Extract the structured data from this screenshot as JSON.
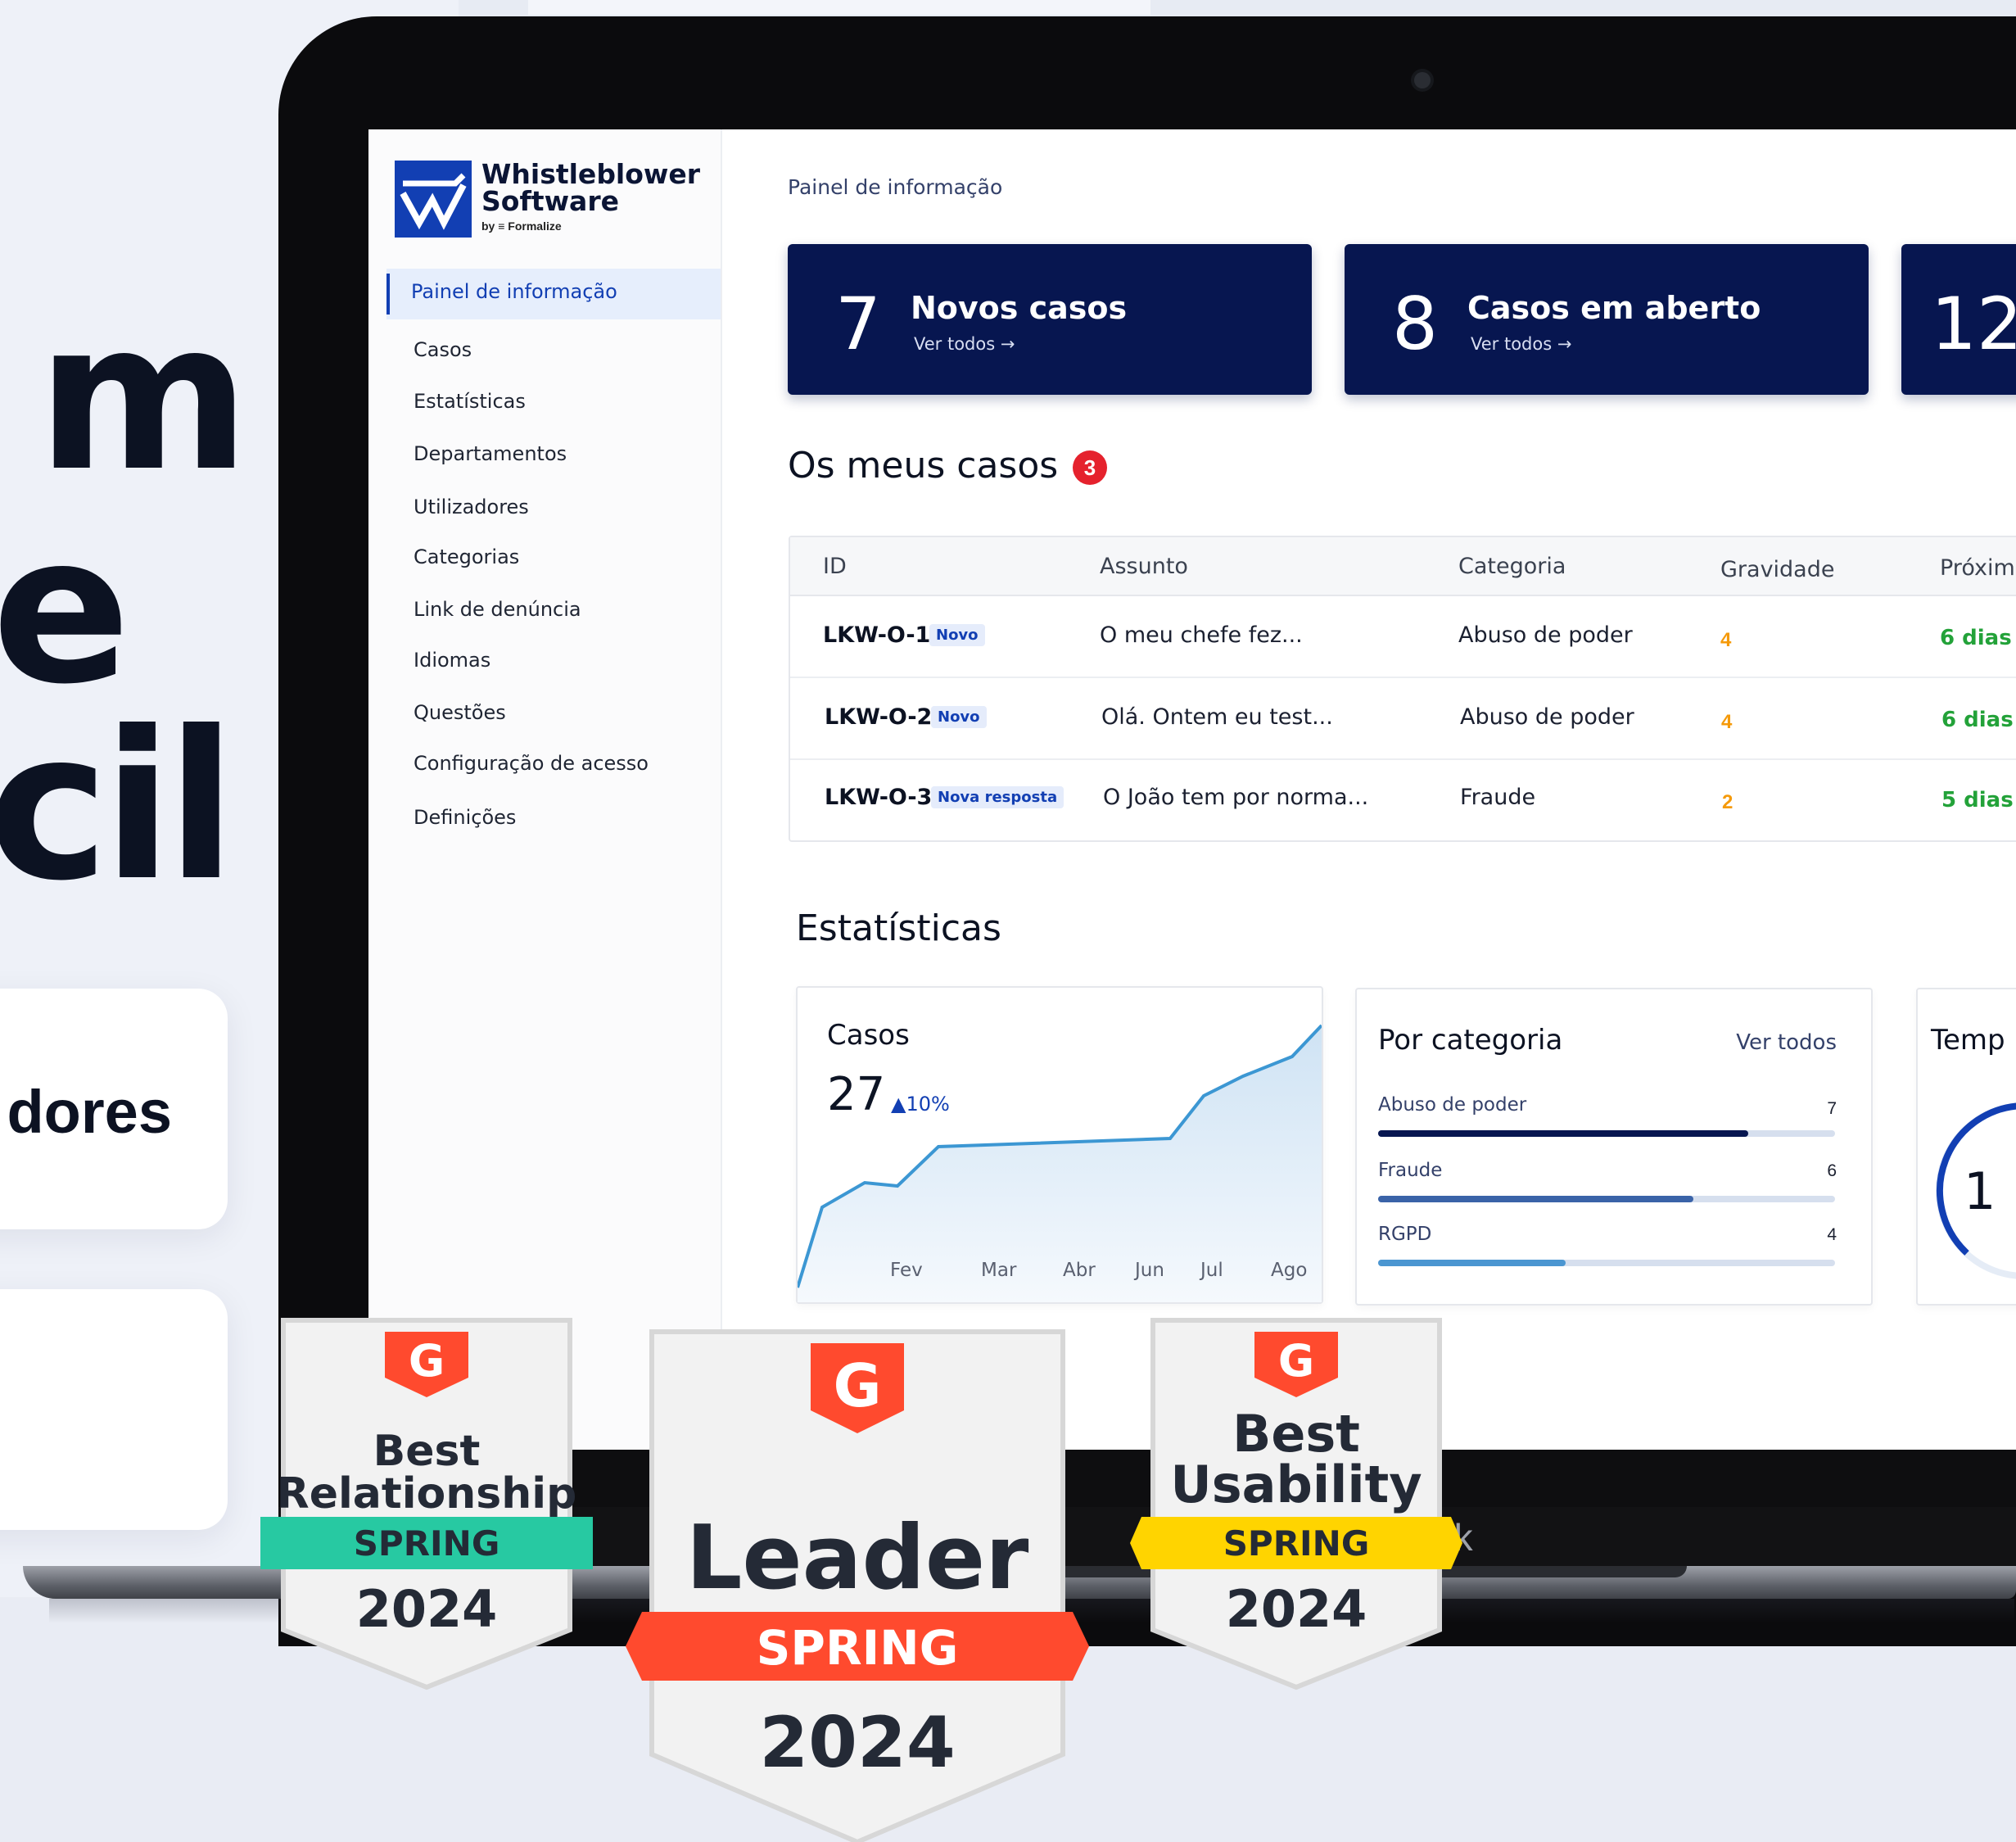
{
  "hero": {
    "line1": "m o",
    "line2": "e",
    "line3": "cil"
  },
  "features": [
    {
      "text": "dores"
    },
    {
      "text": ""
    }
  ],
  "laptop": {
    "chin_brand": "ok"
  },
  "app": {
    "brand_line1": "Whistleblower",
    "brand_line2": "Software",
    "brand_by": "by  ≡ Formalize",
    "nav": [
      {
        "label": "Painel de informação",
        "active": true
      },
      {
        "label": "Casos"
      },
      {
        "label": "Estatísticas"
      },
      {
        "label": "Departamentos"
      },
      {
        "label": "Utilizadores"
      },
      {
        "label": "Categorias"
      },
      {
        "label": "Link de denúncia"
      },
      {
        "label": "Idiomas"
      },
      {
        "label": "Questões"
      },
      {
        "label": "Configuração de acesso"
      },
      {
        "label": "Definições"
      }
    ],
    "breadcrumb": "Painel de informação",
    "stats": [
      {
        "value": "7",
        "title": "Novos casos",
        "link": "Ver todos →"
      },
      {
        "value": "8",
        "title": "Casos em aberto",
        "link": "Ver todos →"
      },
      {
        "value": "12",
        "title": "",
        "link": ""
      }
    ],
    "my_cases": {
      "title": "Os meus casos",
      "badge": "3",
      "columns": [
        "ID",
        "Assunto",
        "Categoria",
        "Gravidade",
        "Próxim"
      ],
      "rows": [
        {
          "id": "LKW-O-1",
          "tag": "Novo",
          "subject": "O meu chefe fez...",
          "category": "Abuso de poder",
          "severity": "4",
          "next": "6 dias"
        },
        {
          "id": "LKW-O-2",
          "tag": "Novo",
          "subject": "Olá. Ontem eu test...",
          "category": "Abuso de poder",
          "severity": "4",
          "next": "6 dias"
        },
        {
          "id": "LKW-O-3",
          "tag": "Nova resposta",
          "subject": "O João tem por norma...",
          "category": "Fraude",
          "severity": "2",
          "next": "5 dias"
        }
      ]
    },
    "statistics": {
      "title": "Estatísticas",
      "cases_panel": {
        "title": "Casos",
        "total": "27",
        "delta": "▲10%",
        "months": [
          "Fev",
          "Mar",
          "Abr",
          "Jun",
          "Jul",
          "Ago"
        ]
      },
      "category_panel": {
        "title": "Por categoria",
        "link": "Ver todos",
        "items": [
          {
            "label": "Abuso de poder",
            "value": "7",
            "fraction": 0.81,
            "color": "#071650"
          },
          {
            "label": "Fraude",
            "value": "6",
            "fraction": 0.69,
            "color": "#3a63a8"
          },
          {
            "label": "RGPD",
            "value": "4",
            "fraction": 0.41,
            "color": "#4b96d1"
          }
        ]
      },
      "time_panel": {
        "title": "Temp",
        "value": "1"
      }
    }
  },
  "badges": [
    {
      "line1": "Best",
      "line2": "Relationship",
      "season": "SPRING",
      "year": "2024",
      "ribbon": "#27c9a2"
    },
    {
      "line1": "Leader",
      "season": "SPRING",
      "year": "2024",
      "ribbon": "#ff4a2e"
    },
    {
      "line1": "Best",
      "line2": "Usability",
      "season": "SPRING",
      "year": "2024",
      "ribbon": "#ffd400"
    }
  ],
  "colors": {
    "navy": "#071650",
    "brand_blue": "#123fb3",
    "g2_red": "#ff4a2e"
  }
}
